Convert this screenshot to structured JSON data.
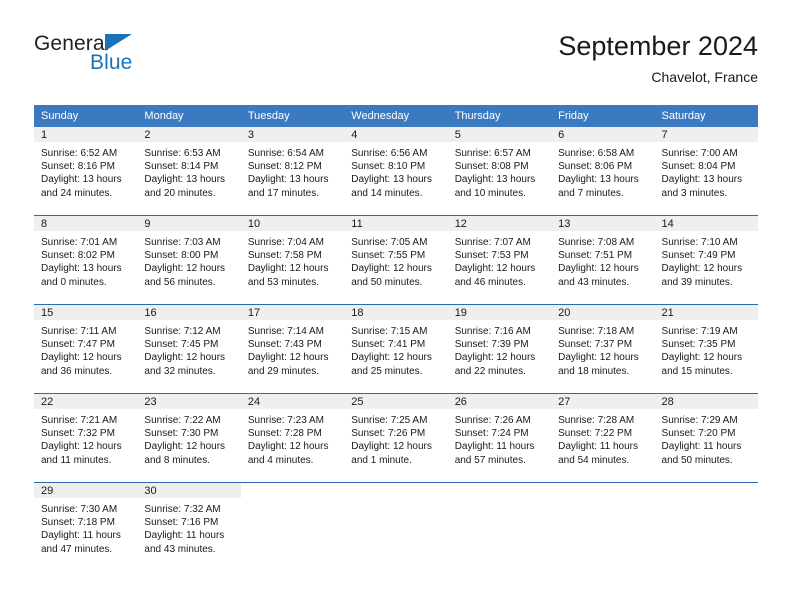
{
  "brand": {
    "name_part1": "General",
    "name_part2": "Blue",
    "triangle_icon": "triangle-icon",
    "color_dark": "#231f20",
    "color_blue": "#1a72b8"
  },
  "header": {
    "title": "September 2024",
    "subtitle": "Chavelot, France"
  },
  "theme": {
    "header_blue": "#3b7ac0",
    "week_separator_blue": "#2a6cb0",
    "daynum_band_gray": "#efefef",
    "text": "#1a1a1a"
  },
  "weekday_headers": [
    "Sunday",
    "Monday",
    "Tuesday",
    "Wednesday",
    "Thursday",
    "Friday",
    "Saturday"
  ],
  "labels": {
    "sunrise_prefix": "Sunrise:",
    "sunset_prefix": "Sunset:",
    "daylight_prefix": "Daylight:"
  },
  "weeks": [
    [
      {
        "day": "1",
        "sunrise": "Sunrise: 6:52 AM",
        "sunset": "Sunset: 8:16 PM",
        "daylight_line1": "Daylight: 13 hours",
        "daylight_line2": "and 24 minutes."
      },
      {
        "day": "2",
        "sunrise": "Sunrise: 6:53 AM",
        "sunset": "Sunset: 8:14 PM",
        "daylight_line1": "Daylight: 13 hours",
        "daylight_line2": "and 20 minutes."
      },
      {
        "day": "3",
        "sunrise": "Sunrise: 6:54 AM",
        "sunset": "Sunset: 8:12 PM",
        "daylight_line1": "Daylight: 13 hours",
        "daylight_line2": "and 17 minutes."
      },
      {
        "day": "4",
        "sunrise": "Sunrise: 6:56 AM",
        "sunset": "Sunset: 8:10 PM",
        "daylight_line1": "Daylight: 13 hours",
        "daylight_line2": "and 14 minutes."
      },
      {
        "day": "5",
        "sunrise": "Sunrise: 6:57 AM",
        "sunset": "Sunset: 8:08 PM",
        "daylight_line1": "Daylight: 13 hours",
        "daylight_line2": "and 10 minutes."
      },
      {
        "day": "6",
        "sunrise": "Sunrise: 6:58 AM",
        "sunset": "Sunset: 8:06 PM",
        "daylight_line1": "Daylight: 13 hours",
        "daylight_line2": "and 7 minutes."
      },
      {
        "day": "7",
        "sunrise": "Sunrise: 7:00 AM",
        "sunset": "Sunset: 8:04 PM",
        "daylight_line1": "Daylight: 13 hours",
        "daylight_line2": "and 3 minutes."
      }
    ],
    [
      {
        "day": "8",
        "sunrise": "Sunrise: 7:01 AM",
        "sunset": "Sunset: 8:02 PM",
        "daylight_line1": "Daylight: 13 hours",
        "daylight_line2": "and 0 minutes."
      },
      {
        "day": "9",
        "sunrise": "Sunrise: 7:03 AM",
        "sunset": "Sunset: 8:00 PM",
        "daylight_line1": "Daylight: 12 hours",
        "daylight_line2": "and 56 minutes."
      },
      {
        "day": "10",
        "sunrise": "Sunrise: 7:04 AM",
        "sunset": "Sunset: 7:58 PM",
        "daylight_line1": "Daylight: 12 hours",
        "daylight_line2": "and 53 minutes."
      },
      {
        "day": "11",
        "sunrise": "Sunrise: 7:05 AM",
        "sunset": "Sunset: 7:55 PM",
        "daylight_line1": "Daylight: 12 hours",
        "daylight_line2": "and 50 minutes."
      },
      {
        "day": "12",
        "sunrise": "Sunrise: 7:07 AM",
        "sunset": "Sunset: 7:53 PM",
        "daylight_line1": "Daylight: 12 hours",
        "daylight_line2": "and 46 minutes."
      },
      {
        "day": "13",
        "sunrise": "Sunrise: 7:08 AM",
        "sunset": "Sunset: 7:51 PM",
        "daylight_line1": "Daylight: 12 hours",
        "daylight_line2": "and 43 minutes."
      },
      {
        "day": "14",
        "sunrise": "Sunrise: 7:10 AM",
        "sunset": "Sunset: 7:49 PM",
        "daylight_line1": "Daylight: 12 hours",
        "daylight_line2": "and 39 minutes."
      }
    ],
    [
      {
        "day": "15",
        "sunrise": "Sunrise: 7:11 AM",
        "sunset": "Sunset: 7:47 PM",
        "daylight_line1": "Daylight: 12 hours",
        "daylight_line2": "and 36 minutes."
      },
      {
        "day": "16",
        "sunrise": "Sunrise: 7:12 AM",
        "sunset": "Sunset: 7:45 PM",
        "daylight_line1": "Daylight: 12 hours",
        "daylight_line2": "and 32 minutes."
      },
      {
        "day": "17",
        "sunrise": "Sunrise: 7:14 AM",
        "sunset": "Sunset: 7:43 PM",
        "daylight_line1": "Daylight: 12 hours",
        "daylight_line2": "and 29 minutes."
      },
      {
        "day": "18",
        "sunrise": "Sunrise: 7:15 AM",
        "sunset": "Sunset: 7:41 PM",
        "daylight_line1": "Daylight: 12 hours",
        "daylight_line2": "and 25 minutes."
      },
      {
        "day": "19",
        "sunrise": "Sunrise: 7:16 AM",
        "sunset": "Sunset: 7:39 PM",
        "daylight_line1": "Daylight: 12 hours",
        "daylight_line2": "and 22 minutes."
      },
      {
        "day": "20",
        "sunrise": "Sunrise: 7:18 AM",
        "sunset": "Sunset: 7:37 PM",
        "daylight_line1": "Daylight: 12 hours",
        "daylight_line2": "and 18 minutes."
      },
      {
        "day": "21",
        "sunrise": "Sunrise: 7:19 AM",
        "sunset": "Sunset: 7:35 PM",
        "daylight_line1": "Daylight: 12 hours",
        "daylight_line2": "and 15 minutes."
      }
    ],
    [
      {
        "day": "22",
        "sunrise": "Sunrise: 7:21 AM",
        "sunset": "Sunset: 7:32 PM",
        "daylight_line1": "Daylight: 12 hours",
        "daylight_line2": "and 11 minutes."
      },
      {
        "day": "23",
        "sunrise": "Sunrise: 7:22 AM",
        "sunset": "Sunset: 7:30 PM",
        "daylight_line1": "Daylight: 12 hours",
        "daylight_line2": "and 8 minutes."
      },
      {
        "day": "24",
        "sunrise": "Sunrise: 7:23 AM",
        "sunset": "Sunset: 7:28 PM",
        "daylight_line1": "Daylight: 12 hours",
        "daylight_line2": "and 4 minutes."
      },
      {
        "day": "25",
        "sunrise": "Sunrise: 7:25 AM",
        "sunset": "Sunset: 7:26 PM",
        "daylight_line1": "Daylight: 12 hours",
        "daylight_line2": "and 1 minute."
      },
      {
        "day": "26",
        "sunrise": "Sunrise: 7:26 AM",
        "sunset": "Sunset: 7:24 PM",
        "daylight_line1": "Daylight: 11 hours",
        "daylight_line2": "and 57 minutes."
      },
      {
        "day": "27",
        "sunrise": "Sunrise: 7:28 AM",
        "sunset": "Sunset: 7:22 PM",
        "daylight_line1": "Daylight: 11 hours",
        "daylight_line2": "and 54 minutes."
      },
      {
        "day": "28",
        "sunrise": "Sunrise: 7:29 AM",
        "sunset": "Sunset: 7:20 PM",
        "daylight_line1": "Daylight: 11 hours",
        "daylight_line2": "and 50 minutes."
      }
    ],
    [
      {
        "day": "29",
        "sunrise": "Sunrise: 7:30 AM",
        "sunset": "Sunset: 7:18 PM",
        "daylight_line1": "Daylight: 11 hours",
        "daylight_line2": "and 47 minutes."
      },
      {
        "day": "30",
        "sunrise": "Sunrise: 7:32 AM",
        "sunset": "Sunset: 7:16 PM",
        "daylight_line1": "Daylight: 11 hours",
        "daylight_line2": "and 43 minutes."
      },
      {
        "day": "",
        "sunrise": "",
        "sunset": "",
        "daylight_line1": "",
        "daylight_line2": ""
      },
      {
        "day": "",
        "sunrise": "",
        "sunset": "",
        "daylight_line1": "",
        "daylight_line2": ""
      },
      {
        "day": "",
        "sunrise": "",
        "sunset": "",
        "daylight_line1": "",
        "daylight_line2": ""
      },
      {
        "day": "",
        "sunrise": "",
        "sunset": "",
        "daylight_line1": "",
        "daylight_line2": ""
      },
      {
        "day": "",
        "sunrise": "",
        "sunset": "",
        "daylight_line1": "",
        "daylight_line2": ""
      }
    ]
  ]
}
